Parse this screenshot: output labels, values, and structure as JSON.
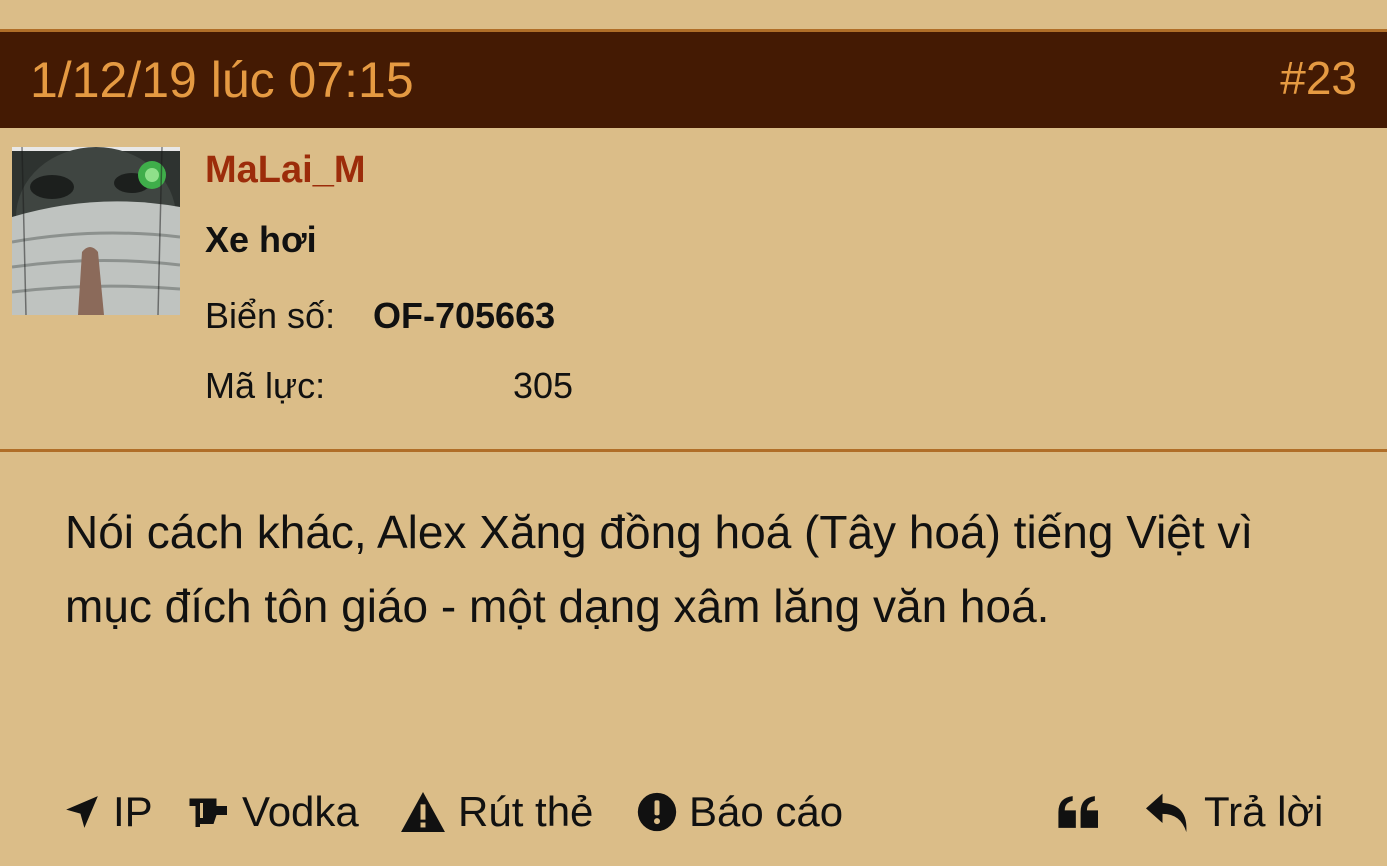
{
  "post": {
    "date": "1/12/19 lúc 07:15",
    "number": "#23"
  },
  "user": {
    "username": "MaLai_M",
    "title": "Xe hơi",
    "stats": [
      {
        "label": "Biển số:",
        "value": "OF-705663"
      },
      {
        "label": "Mã lực:",
        "value": "305"
      }
    ]
  },
  "message": {
    "text": "Nói cách khác, Alex Xăng đồng hoá (Tây hoá) tiếng Việt vì mục đích tôn giáo - một dạng xâm lăng văn hoá."
  },
  "actions": {
    "ip": {
      "label": "IP",
      "icon": "location-arrow-icon"
    },
    "vodka": {
      "label": "Vodka",
      "icon": "glass-icon"
    },
    "card": {
      "label": "Rút thẻ",
      "icon": "warning-icon"
    },
    "report": {
      "label": "Báo cáo",
      "icon": "exclamation-circle-icon"
    },
    "quote": {
      "icon": "quote-icon"
    },
    "reply": {
      "label": "Trả lời",
      "icon": "reply-icon"
    }
  },
  "colors": {
    "background": "#dbbd88",
    "header": "#441a03",
    "header_text": "#e59a42",
    "username": "#9c2c0a",
    "divider": "#b06e28"
  }
}
